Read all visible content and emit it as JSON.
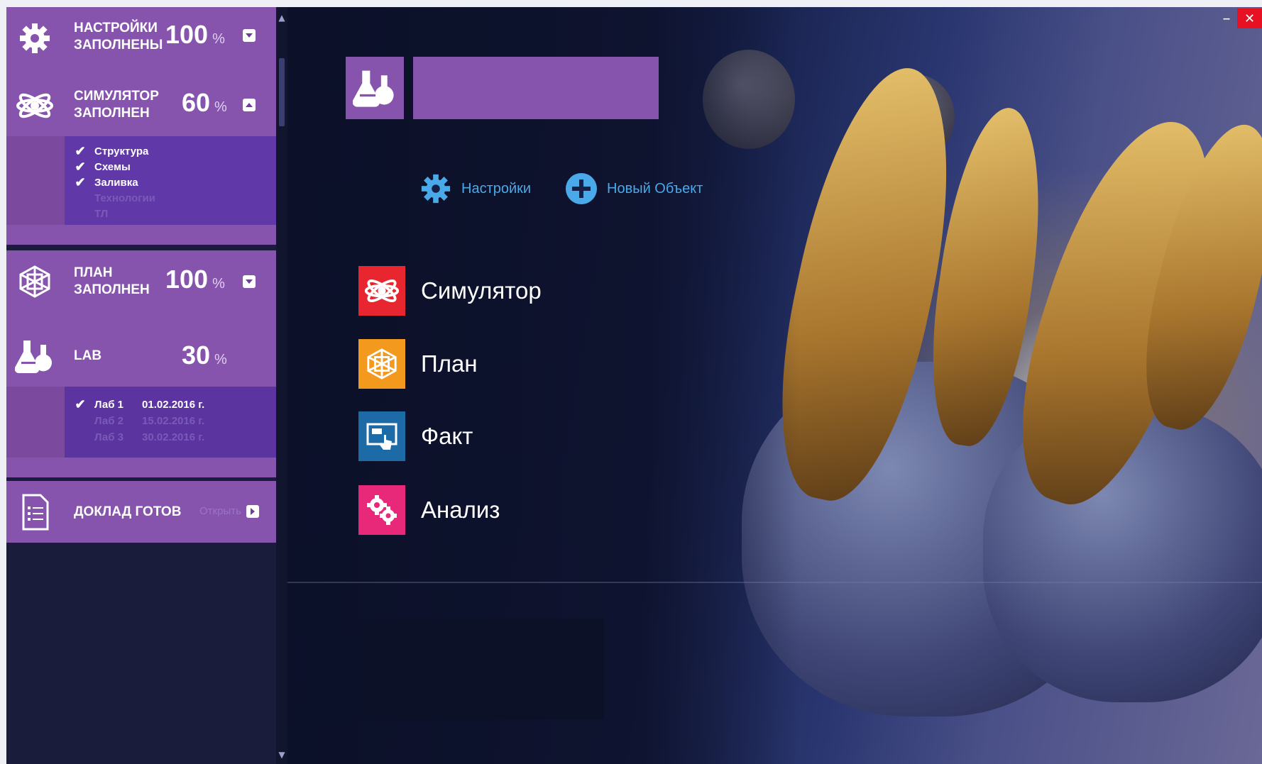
{
  "sidebar": {
    "stages": [
      {
        "title": "НАСТРОЙКИ\nЗАПОЛНЕНЫ",
        "percent": "100",
        "unit": "%",
        "icon": "gear-icon",
        "toggle": "collapse"
      },
      {
        "title": "СИМУЛЯТОР\nЗАПОЛНЕН",
        "percent": "60",
        "unit": "%",
        "icon": "atom-icon",
        "toggle": "expand"
      },
      {
        "title": "ПЛАН\nЗАПОЛНЕН",
        "percent": "100",
        "unit": "%",
        "icon": "network-cube-icon",
        "toggle": "collapse"
      },
      {
        "title": "LAB",
        "percent": "30",
        "unit": "%",
        "icon": "flasks-icon"
      },
      {
        "title": "ДОКЛАД ГОТОВ",
        "action": "Открыть",
        "icon": "document-icon"
      }
    ],
    "simulator_checklist": [
      {
        "label": "Структура",
        "done": true
      },
      {
        "label": "Схемы",
        "done": true
      },
      {
        "label": "Заливка",
        "done": true
      },
      {
        "label": "Технологии",
        "done": false
      },
      {
        "label": "ТЛ",
        "done": false
      }
    ],
    "labs": [
      {
        "label": "Лаб 1",
        "date": "01.02.2016 г.",
        "done": true
      },
      {
        "label": "Лаб 2",
        "date": "15.02.2016 г.",
        "done": false
      },
      {
        "label": "Лаб 3",
        "date": "30.02.2016 г.",
        "done": false
      }
    ]
  },
  "main": {
    "quick_actions": [
      {
        "label": "Настройки",
        "icon": "gear-icon"
      },
      {
        "label": "Новый Объект",
        "icon": "plus-circle-icon"
      }
    ],
    "menu": [
      {
        "label": "Симулятор",
        "icon": "atom-icon",
        "color": "#e8262f"
      },
      {
        "label": "План",
        "icon": "network-cube-icon",
        "color": "#f39a1e"
      },
      {
        "label": "Факт",
        "icon": "touch-screen-icon",
        "color": "#1c6aa6"
      },
      {
        "label": "Анализ",
        "icon": "gears-icon",
        "color": "#e8297a"
      }
    ]
  },
  "window": {
    "minimize": "–",
    "close": "✕"
  },
  "colors": {
    "accent": "#8653ad",
    "sidebar_bg": "#191c3a",
    "link": "#4aa9e8"
  }
}
